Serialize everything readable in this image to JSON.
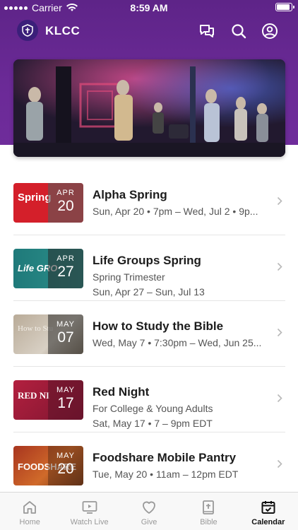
{
  "status": {
    "carrier": "Carrier",
    "time": "8:59 AM"
  },
  "header": {
    "app_title": "KLCC",
    "icons": [
      "chat-icon",
      "search-icon",
      "profile-icon"
    ]
  },
  "colors": {
    "brand_purple": "#6b2a97",
    "accent_red": "#d41f2a"
  },
  "events": [
    {
      "title": "Alpha Spring",
      "line1": "Sun, Apr 20 • 7pm – Wed, Jul 2 • 9p...",
      "line2": "",
      "month": "APR",
      "day": "20",
      "thumb_text": "Spring"
    },
    {
      "title": "Life Groups Spring",
      "line1": "Spring Trimester",
      "line2": "Sun, Apr 27 – Sun, Jul 13",
      "month": "APR",
      "day": "27",
      "thumb_text": "Life GRO"
    },
    {
      "title": "How to Study the Bible",
      "line1": "Wed, May 7 • 7:30pm – Wed, Jun 25...",
      "line2": "",
      "month": "MAY",
      "day": "07",
      "thumb_text": "How to Stu"
    },
    {
      "title": "Red Night",
      "line1": "For College & Young Adults",
      "line2": "Sat, May 17 • 7 – 9pm EDT",
      "month": "MAY",
      "day": "17",
      "thumb_text": "RED NI"
    },
    {
      "title": "Foodshare Mobile Pantry",
      "line1": "Tue, May 20 • 11am – 12pm EDT",
      "line2": "",
      "month": "MAY",
      "day": "20",
      "thumb_text": "FOODSHARE"
    }
  ],
  "tabs": [
    {
      "label": "Home",
      "icon": "home-icon",
      "active": false
    },
    {
      "label": "Watch Live",
      "icon": "tv-icon",
      "active": false
    },
    {
      "label": "Give",
      "icon": "heart-icon",
      "active": false
    },
    {
      "label": "Bible",
      "icon": "bible-icon",
      "active": false
    },
    {
      "label": "Calendar",
      "icon": "calendar-icon",
      "active": true
    }
  ]
}
